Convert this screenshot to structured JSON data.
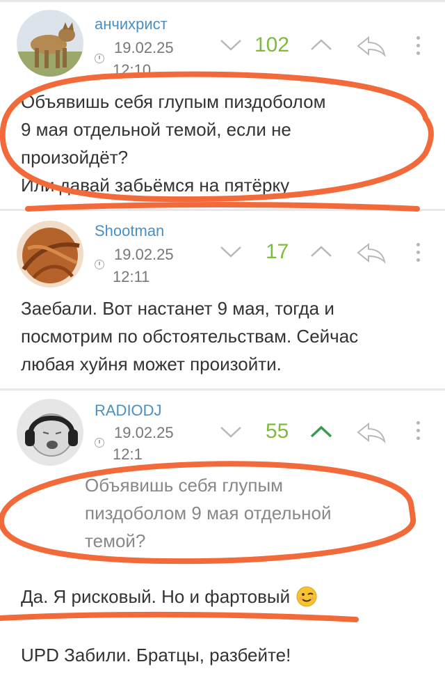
{
  "comments": [
    {
      "username": "анчихрист",
      "date": "19.02.25",
      "time": "12:10",
      "rating": "102",
      "text_lines": [
        "Объявишь себя глупым пиздоболом",
        "9 мая отдельной темой, если не",
        "произойдёт?",
        "Или давай забьёмся на пятёрку"
      ]
    },
    {
      "username": "Shootman",
      "date": "19.02.25",
      "time": "12:11",
      "rating": "17",
      "text_lines": [
        "Заебали. Вот настанет 9 мая, тогда и",
        "посмотрим по обстоятельствам. Сейчас",
        "любая хуйня может произойти."
      ]
    },
    {
      "username": "RADIODJ",
      "date": "19.02.25",
      "time": "12:1",
      "rating": "55",
      "quote_lines": [
        "Объявишь себя глупым",
        "пиздоболом 9 мая отдельной",
        "темой?"
      ],
      "reply_line": "Да. Я рисковый. Но и фартовый",
      "update_line": "UPD Забили. Братцы, разбейте!"
    }
  ],
  "icons": {
    "vote_down": "chevron-down-icon",
    "vote_up": "chevron-up-icon",
    "reply": "reply-arrow-icon",
    "more": "more-vertical-icon",
    "clock": "clock-icon",
    "emoji": "winking-face-emoji"
  },
  "colors": {
    "username": "#4a8fc4",
    "rating": "#7dbb3d",
    "vote_up_active": "#3a9a4e",
    "annotation": "#f26a3a"
  }
}
